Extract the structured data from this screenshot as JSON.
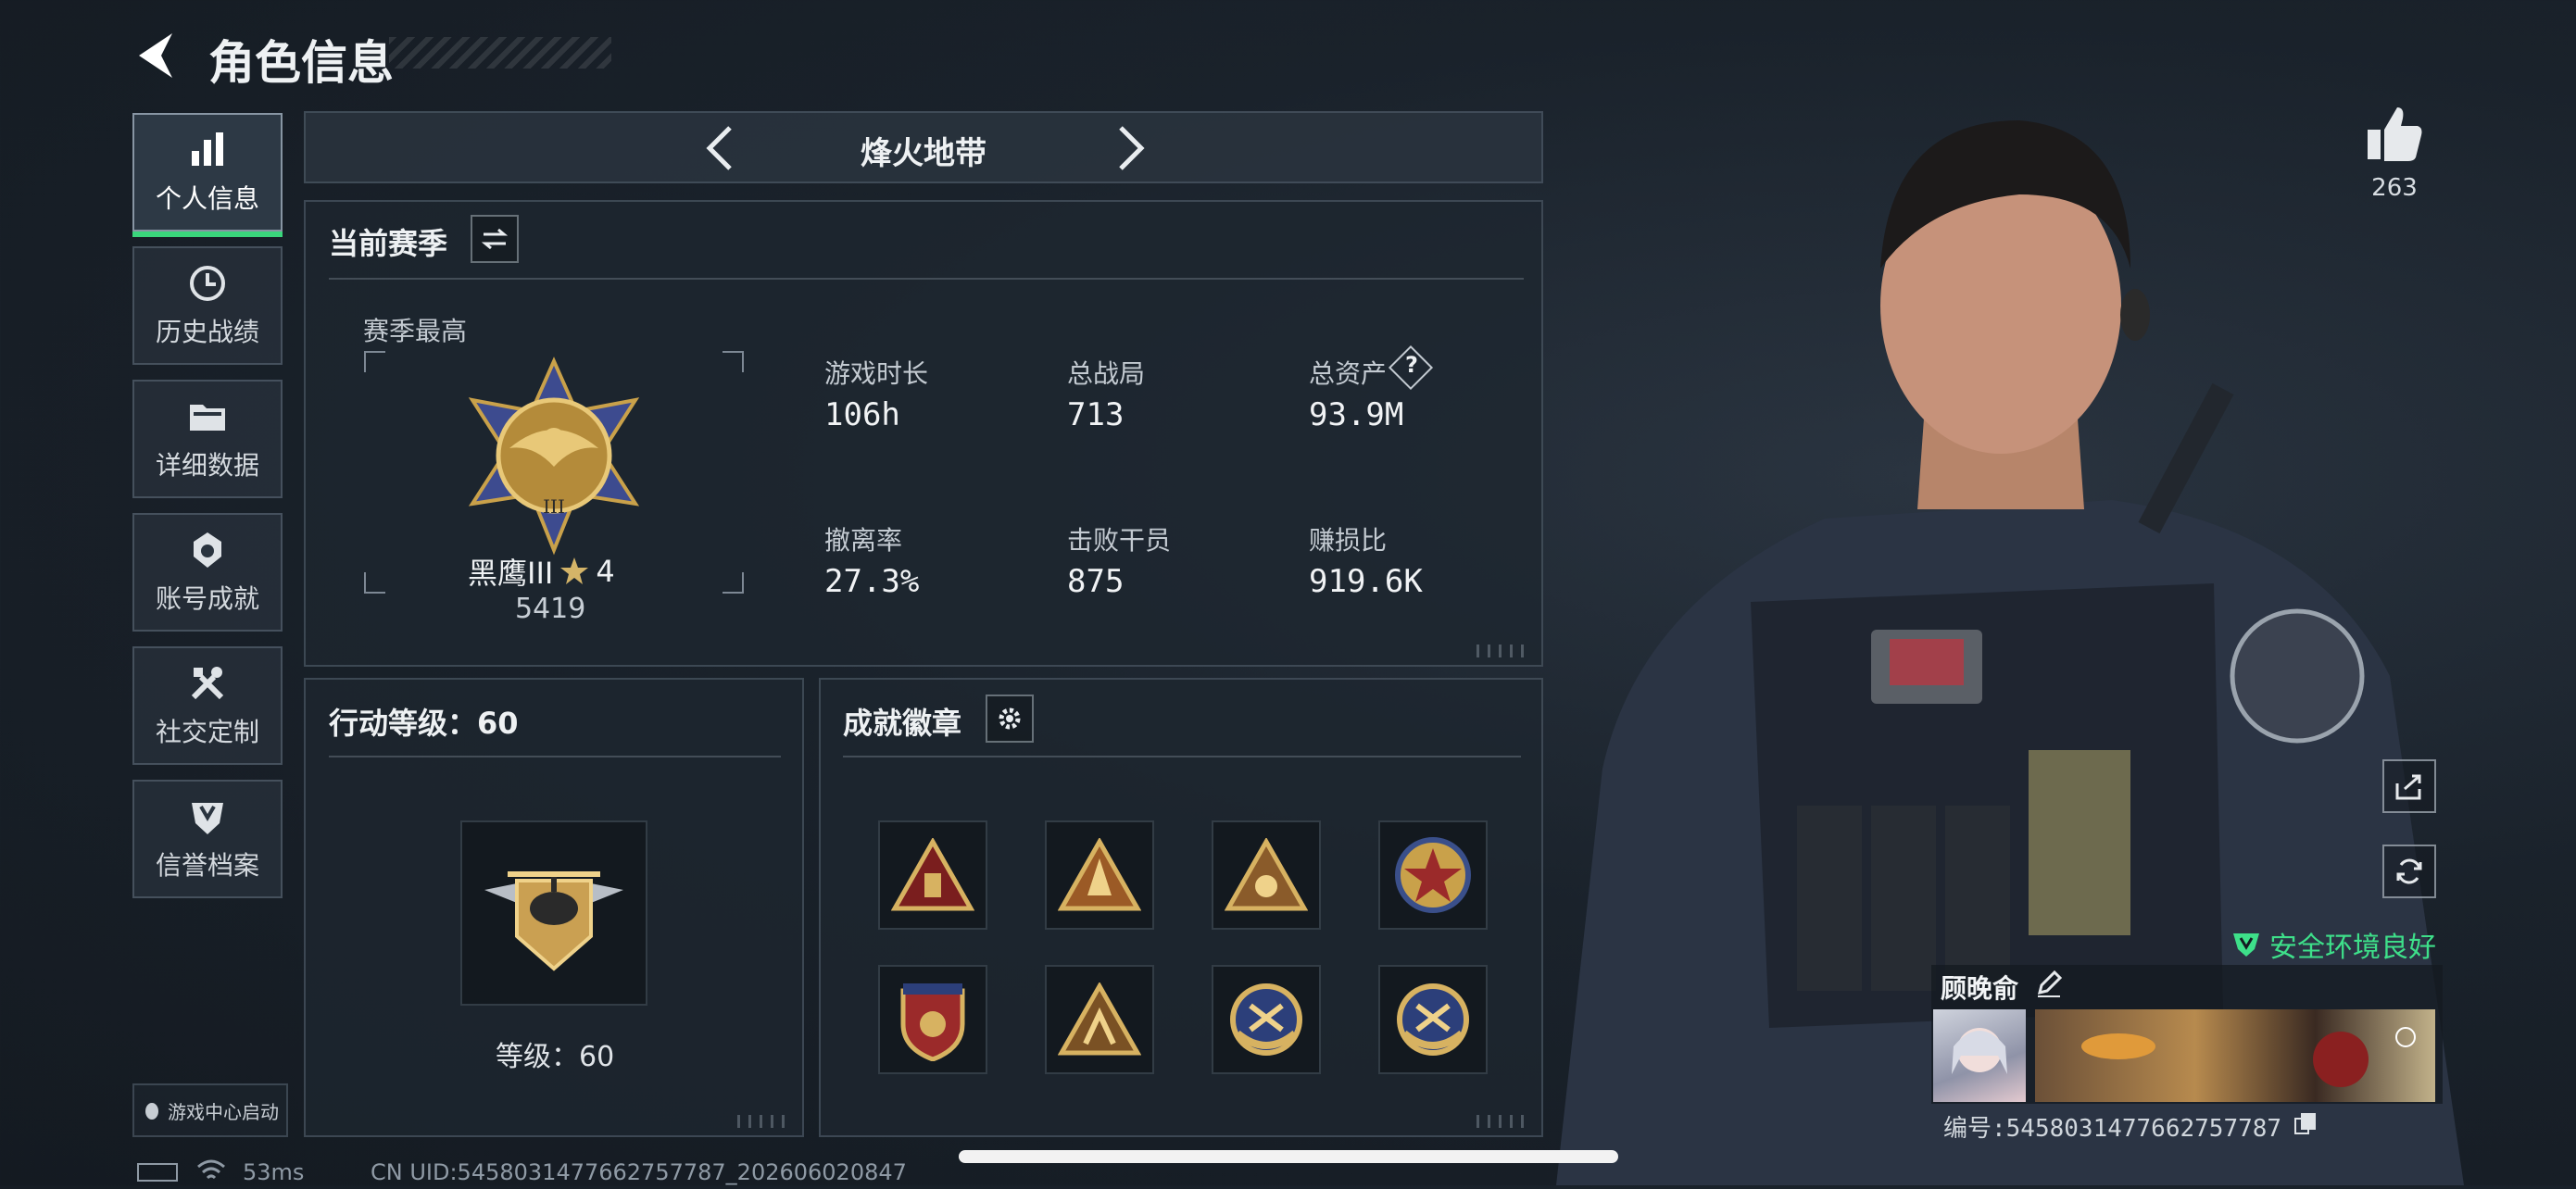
{
  "header": {
    "title": "角色信息"
  },
  "sidebar": {
    "items": [
      {
        "label": "个人信息",
        "icon": "bar-chart-icon",
        "active": true
      },
      {
        "label": "历史战绩",
        "icon": "history-clock-icon"
      },
      {
        "label": "详细数据",
        "icon": "folder-icon"
      },
      {
        "label": "账号成就",
        "icon": "medal-icon"
      },
      {
        "label": "社交定制",
        "icon": "tools-icon"
      },
      {
        "label": "信誉档案",
        "icon": "shield-icon"
      }
    ],
    "launch_label": "游戏中心启动"
  },
  "mode": {
    "name": "烽火地带"
  },
  "season": {
    "title": "当前赛季",
    "best_label": "赛季最高",
    "rank_name": "黑鹰III",
    "rank_stars": "4",
    "rank_score": "5419",
    "stats": [
      {
        "label": "游戏时长",
        "value": "106h"
      },
      {
        "label": "总战局",
        "value": "713"
      },
      {
        "label": "总资产",
        "value": "93.9M",
        "help": "?"
      },
      {
        "label": "撤离率",
        "value": "27.3%"
      },
      {
        "label": "击败干员",
        "value": "875"
      },
      {
        "label": "赚损比",
        "value": "919.6K"
      }
    ]
  },
  "action_level": {
    "title": "行动等级：60",
    "level_text": "等级：60"
  },
  "achievements": {
    "title": "成就徽章",
    "badges": [
      "triangle-badge-1",
      "triangle-badge-2",
      "triangle-badge-3",
      "star-round-badge",
      "shield-stars-badge",
      "triangle-badge-4",
      "round-wings-badge-1",
      "round-wings-badge-2"
    ]
  },
  "character": {
    "likes": "263",
    "status": "安全环境良好",
    "player_name": "顾晚俞",
    "player_id": "编号:5458031477662757787"
  },
  "footer": {
    "ping": "53ms",
    "uid": "CN UID:5458031477662757787_202606020847"
  },
  "colors": {
    "accent": "#3ad67c",
    "gold": "#c9a14a",
    "panel": "#1e262f"
  }
}
